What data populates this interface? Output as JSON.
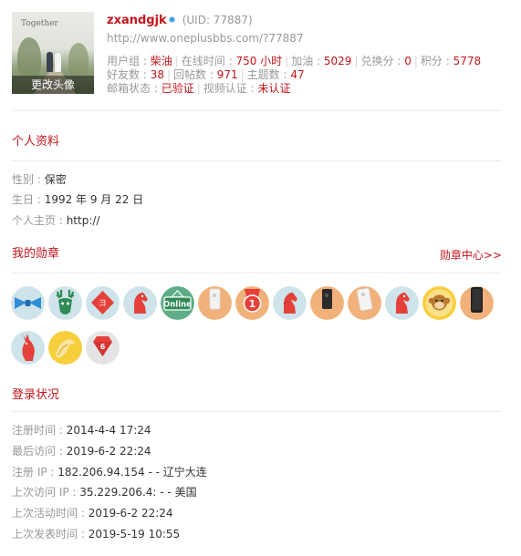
{
  "profile": {
    "avatar_caption": "更改头像",
    "avatar_scribble": "Together",
    "username": "zxandgjk",
    "uid_text": "(UID: 77887)",
    "url": "http://www.oneplusbbs.com/?77887",
    "stats_line1": [
      {
        "label": "用户组 : ",
        "value": "柴油"
      },
      {
        "label": "在线时间 : ",
        "value": "750 小时"
      },
      {
        "label": "加油 : ",
        "value": "5029"
      },
      {
        "label": "兑换分 : ",
        "value": "0"
      },
      {
        "label": "积分 : ",
        "value": "5778"
      }
    ],
    "stats_line2": [
      {
        "label": "好友数 : ",
        "value": "38"
      },
      {
        "label": "回帖数 : ",
        "value": "971"
      },
      {
        "label": "主题数 : ",
        "value": "47"
      }
    ],
    "stats_line3": [
      {
        "label": "邮箱状态 : ",
        "value": "已验证"
      },
      {
        "label": "视频认证 : ",
        "value": "未认证"
      }
    ]
  },
  "personal": {
    "title": "个人资料",
    "gender_label": "性别 : ",
    "gender": "保密",
    "birthday_label": "生日 : ",
    "birthday": "1992 年 9 月 22 日",
    "homepage_label": "个人主页 : ",
    "homepage": "http://"
  },
  "medals": {
    "title": "我的勋章",
    "center_link": "勋章中心>>",
    "badge_online_text": "Online",
    "badge_one_text": "1",
    "badge_six_text": "6",
    "items": [
      {
        "name": "bowtie-medal-icon",
        "bg": "#cfe3ea"
      },
      {
        "name": "reindeer-medal-icon",
        "bg": "#cfe3ea"
      },
      {
        "name": "red-envelope-medal-icon",
        "bg": "#cfe3ea"
      },
      {
        "name": "red-knight-medal-icon",
        "bg": "#cfe3ea"
      },
      {
        "name": "online-sign-medal-icon",
        "bg": "#5fae88"
      },
      {
        "name": "white-phone-medal-icon",
        "bg": "#f0b27a"
      },
      {
        "name": "number-one-medal-icon",
        "bg": "#f0b27a"
      },
      {
        "name": "red-knight-medal-icon-2",
        "bg": "#cfe3ea"
      },
      {
        "name": "black-phone-medal-icon",
        "bg": "#f0b27a"
      },
      {
        "name": "white-phone-medal-icon-2",
        "bg": "#f0b27a"
      },
      {
        "name": "red-knight-medal-icon-3",
        "bg": "#cfe3ea"
      },
      {
        "name": "monkey-medal-icon",
        "bg": "#f7cf3c"
      },
      {
        "name": "dark-phone-medal-icon",
        "bg": "#f0b27a"
      },
      {
        "name": "red-fox-medal-icon",
        "bg": "#cfe3ea"
      },
      {
        "name": "golden-bird-medal-icon",
        "bg": "#f7cf3c"
      },
      {
        "name": "red-gem-six-medal-icon",
        "bg": "#e4e4e4"
      }
    ]
  },
  "login": {
    "title": "登录状况",
    "rows": [
      {
        "label": "注册时间 : ",
        "value": "2014-4-4 17:24"
      },
      {
        "label": "最后访问 : ",
        "value": "2019-6-2 22:24"
      },
      {
        "label": "注册 IP : ",
        "value": "182.206.94.154 - - 辽宁大连"
      },
      {
        "label": "上次访问 IP : ",
        "value": "35.229.206.4: - - 美国"
      },
      {
        "label": "上次活动时间 : ",
        "value": "2019-6-2 22:24"
      },
      {
        "label": "上次发表时间 : ",
        "value": "2019-5-19 10:55"
      }
    ]
  },
  "colors": {
    "accent": "#c4161c",
    "muted": "#999999",
    "text": "#333333",
    "divider": "#ebebeb"
  }
}
